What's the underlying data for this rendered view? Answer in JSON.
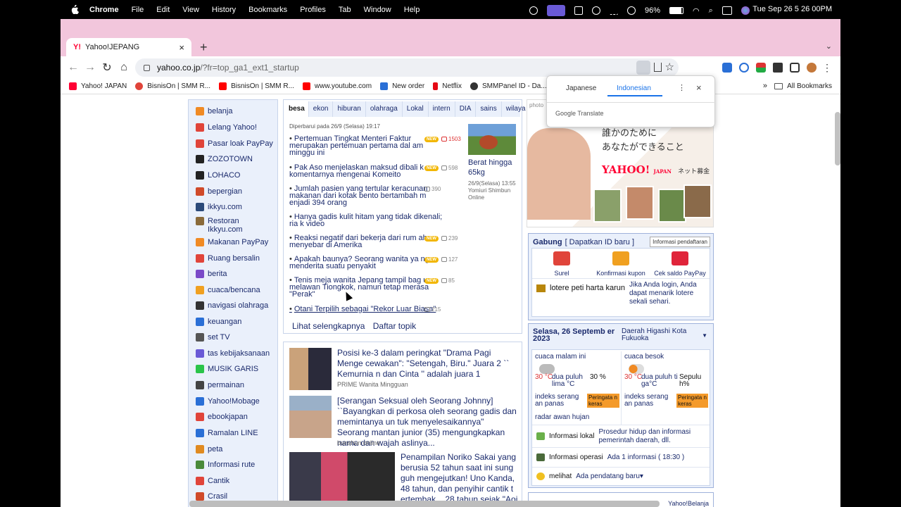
{
  "menubar": {
    "items": [
      "Chrome",
      "File",
      "Edit",
      "View",
      "History",
      "Bookmarks",
      "Profiles",
      "Tab",
      "Window",
      "Help"
    ],
    "battery": "96%",
    "clock": "Tue Sep 26  5 26 00PM"
  },
  "browser": {
    "tab_title": "Yahoo!JEPANG",
    "tab_logo": "Y!",
    "url_host": "yahoo.co.jp",
    "url_path": "/?fr=top_ga1_ext1_startup",
    "bookmarks": [
      {
        "label": "Yahoo! JAPAN",
        "color": "#ff0033"
      },
      {
        "label": "BisnisOn | SMM R...",
        "color": "#e0443a"
      },
      {
        "label": "BisnisOn | SMM R...",
        "color": "#ff0000"
      },
      {
        "label": "www.youtube.com",
        "color": "#ff0000"
      },
      {
        "label": "New order",
        "color": "#2a6fd6"
      },
      {
        "label": "Netflix",
        "color": "#e50914"
      },
      {
        "label": "SMMPanel ID - Da...",
        "color": "#333333"
      }
    ],
    "bookmarks_more": "»",
    "all_bookmarks": "All Bookmarks"
  },
  "translate_popup": {
    "source_lang": "Japanese",
    "target_lang": "Indonesian",
    "brand": "Google Translate"
  },
  "leftnav": [
    {
      "label": "belanja",
      "color": "#f08a24"
    },
    {
      "label": "Lelang Yahoo!",
      "color": "#e0443a"
    },
    {
      "label": "Pasar loak PayPay",
      "color": "#e0443a"
    },
    {
      "label": "ZOZOTOWN",
      "color": "#222222"
    },
    {
      "label": "LOHACO",
      "color": "#222222"
    },
    {
      "label": "bepergian",
      "color": "#d04a2a"
    },
    {
      "label": "ikkyu.com",
      "color": "#2b4a7a"
    },
    {
      "label": "Restoran Ikkyu.com",
      "color": "#8a6a3a"
    },
    {
      "label": "Makanan PayPay",
      "color": "#f08a24"
    },
    {
      "label": "Ruang bersalin",
      "color": "#e0443a"
    },
    {
      "label": "berita",
      "color": "#7a4ac8"
    },
    {
      "label": "cuaca/bencana",
      "color": "#f0a020"
    },
    {
      "label": "navigasi olahraga",
      "color": "#333333"
    },
    {
      "label": "keuangan",
      "color": "#2a6fd6"
    },
    {
      "label": "set TV",
      "color": "#555555"
    },
    {
      "label": "tas kebijaksanaan",
      "color": "#6a5ad6"
    },
    {
      "label": "MUSIK GARIS",
      "color": "#2ac44a"
    },
    {
      "label": "permainan",
      "color": "#444444"
    },
    {
      "label": "Yahoo!Mobage",
      "color": "#2a6fd6"
    },
    {
      "label": "ebookjapan",
      "color": "#e0443a"
    },
    {
      "label": "Ramalan LINE",
      "color": "#2a6fd6"
    },
    {
      "label": "peta",
      "color": "#e08a20"
    },
    {
      "label": "Informasi rute",
      "color": "#4a8a3a"
    },
    {
      "label": "Cantik",
      "color": "#e0443a"
    },
    {
      "label": "Crasil",
      "color": "#d04a2a"
    }
  ],
  "news": {
    "tabs": [
      "besa",
      "ekon",
      "hiburan",
      "olahraga",
      "Lokal",
      "intern",
      "DIA",
      "sains",
      "wilaya"
    ],
    "updated": "Diperbarui pada 26/9 (Selasa) 19:17",
    "new_badge": "NEW",
    "items": [
      {
        "title": "Pertemuan Tingkat Menteri Faktur merupakan pertemuan pertama dal am minggu ini",
        "new": true,
        "count": "1503",
        "hot": true
      },
      {
        "title": "Pak Aso menjelaskan maksud dibali k komentarnya mengenai Komeito",
        "new": true,
        "count": "598",
        "hot": false
      },
      {
        "title": "Jumlah pasien yang tertular keracunan makanan dari kotak bento bertambah m enjadi 394 orang",
        "new": false,
        "count": "390",
        "hot": false
      },
      {
        "title": "Hanya gadis kulit hitam yang tidak dikenali; ria k video",
        "new": false,
        "count": "",
        "hot": false
      },
      {
        "title": "Reaksi negatif dari bekerja dari rum ah menyebar di Amerika",
        "new": true,
        "count": "239",
        "hot": false
      },
      {
        "title": "Apakah baunya? Seorang wanita ya ng menderita suatu penyakit",
        "new": true,
        "count": "127",
        "hot": false
      },
      {
        "title": "Tenis meja wanita Jepang tampil bag us melawan Tiongkok, namun tetap merasa \"Perak\"",
        "new": true,
        "count": "85",
        "hot": false
      },
      {
        "title": "Otani Terpilih sebagai \"Rekor Luar Biasa\"",
        "new": false,
        "count": "215",
        "hot": false
      }
    ],
    "topic": {
      "caption": "Berat hingga 65kg",
      "date": "26/9(Selasa) 13:55",
      "source": "Yomiuri Shimbun Online"
    },
    "more_label": "Lihat selengkapnya",
    "topics_label": "Daftar topik"
  },
  "feed": [
    {
      "title": "Posisi ke-3 dalam peringkat \"Drama Pagi Menge cewakan\": \"Setengah, Biru.\" Juara 2 `` Kemurnia n dan Cinta '' adalah juara 1",
      "source": "PRIME Wanita Mingguan"
    },
    {
      "title": "[Serangan Seksual oleh Seorang Johnny] ``Bayangkan di perkosa oleh seorang gadis dan memintanya un tuk menyelesaikannya\" Seorang mantan junior (35) mengungkapkan nama dan wajah aslinya...",
      "source": "bunshun online"
    },
    {
      "title": "Penampilan Noriko Sakai yang berusia 52 tahun saat ini sung guh mengejutkan! Uno Kanda, 48 tahun, dan penyihir cantik t ertembak... 28 tahun sejak \"Aoi",
      "source": ""
    }
  ],
  "ad": {
    "photo_label": "photo",
    "copy_line1": "誰かのために",
    "copy_line2": "あなたができること",
    "brand": "YAHOO!",
    "brand_sub": "JAPAN",
    "brand_service": "ネット募金"
  },
  "login": {
    "join": "Gabung",
    "get_id": "[ Dapatkan ID baru ]",
    "register": "Informasi pendaftaran",
    "links": [
      {
        "label": "Surel",
        "color": "#e0443a"
      },
      {
        "label": "Konfirmasi kupon",
        "color": "#f0a020"
      },
      {
        "label": "Cek saldo PayPay",
        "color": "#e0243a"
      }
    ],
    "lottery": "lotere peti harta karun",
    "lottery_desc": "Jika Anda login, Anda dapat menarik lotere sekali sehari."
  },
  "weather": {
    "date": "Selasa, 26 Septemb er 2023",
    "location": "Daerah Higashi Kota Fukuoka",
    "tonight": {
      "label": "cuaca malam ini",
      "high": "30 °C",
      "desc": "dua puluh lima °C",
      "pct": "30 %",
      "index": "indeks serang an panas",
      "warn": "Peringata n keras"
    },
    "tomorrow": {
      "label": "cuaca besok",
      "high": "30 °C",
      "desc": "dua puluh ti ga°C",
      "pct": "Sepulu h%",
      "index": "indeks serang an panas",
      "warn": "Peringata n keras"
    },
    "radar": "radar awan hujan",
    "local_label": "Informasi lokal",
    "local_value": "Prosedur hidup dan informasi pemerintah daerah, dll.",
    "ops_label": "Informasi operasi",
    "ops_value": "Ada 1 informasi ( 18:30 )",
    "see_label": "melihat",
    "see_value": "Ada pendatang baru▾"
  },
  "bottom_label": "Yahoo!Belanja"
}
